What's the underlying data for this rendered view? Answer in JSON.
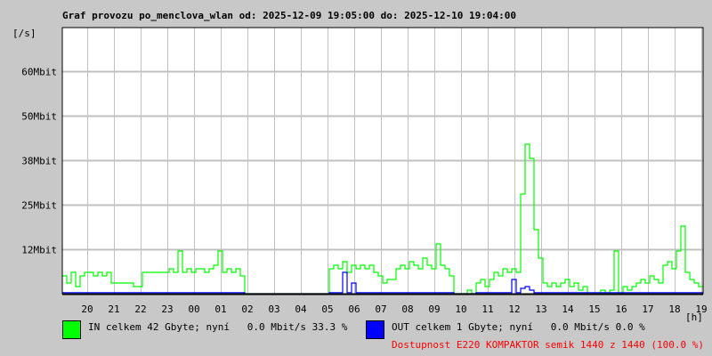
{
  "chart_data": {
    "type": "line",
    "title": "Graf provozu po_menclova_wlan od: 2025-12-09 19:05:00 do: 2025-12-10 19:04:00",
    "ylabel": "[/s]",
    "xlabel": "[h]",
    "ylim": [
      0,
      75
    ],
    "y_unit": "Mbit/s",
    "sample_interval_min": 10,
    "start_time": "19:05",
    "grid": true,
    "y_ticks": [
      {
        "label": "12Mbit",
        "value": 12.5
      },
      {
        "label": "25Mbit",
        "value": 25
      },
      {
        "label": "38Mbit",
        "value": 37.5
      },
      {
        "label": "50Mbit",
        "value": 50
      },
      {
        "label": "60Mbit",
        "value": 62.5
      }
    ],
    "x_ticks": [
      "20",
      "21",
      "22",
      "23",
      "00",
      "01",
      "02",
      "03",
      "04",
      "05",
      "06",
      "07",
      "08",
      "09",
      "10",
      "11",
      "12",
      "13",
      "14",
      "15",
      "16",
      "17",
      "18",
      "19"
    ],
    "series": [
      {
        "name": "IN",
        "color": "#00ff00",
        "values": [
          5,
          3,
          6,
          2,
          5,
          6,
          6,
          5,
          6,
          5,
          6,
          3,
          3,
          3,
          3,
          3,
          2,
          2,
          6,
          6,
          6,
          6,
          6,
          6,
          7,
          6,
          12,
          6,
          7,
          6,
          7,
          7,
          6,
          7,
          8,
          12,
          6,
          7,
          6,
          7,
          5,
          0,
          0,
          0,
          0,
          0,
          0,
          0,
          0,
          0,
          0,
          0,
          0,
          0,
          0,
          0,
          0,
          0,
          0,
          0,
          7,
          8,
          7,
          9,
          6,
          8,
          7,
          8,
          7,
          8,
          6,
          5,
          3,
          4,
          4,
          7,
          8,
          7,
          9,
          8,
          7,
          10,
          8,
          7,
          14,
          8,
          7,
          5,
          0,
          0,
          0,
          1,
          0,
          3,
          4,
          2,
          4,
          6,
          5,
          7,
          6,
          7,
          6,
          28,
          42,
          38,
          18,
          10,
          3,
          2,
          3,
          2,
          3,
          4,
          2,
          3,
          1,
          2,
          0,
          0,
          0,
          1,
          0,
          1,
          12,
          0,
          2,
          1,
          2,
          3,
          4,
          3,
          5,
          4,
          3,
          8,
          9,
          7,
          12,
          19,
          6,
          4,
          3,
          2
        ]
      },
      {
        "name": "OUT",
        "color": "#0000ff",
        "values": [
          0.3,
          0.3,
          0.3,
          0.3,
          0.3,
          0.3,
          0.3,
          0.3,
          0.3,
          0.3,
          0.3,
          0.3,
          0.3,
          0.3,
          0.3,
          0.3,
          0.3,
          0.3,
          0.3,
          0.3,
          0.3,
          0.3,
          0.3,
          0.3,
          0.3,
          0.3,
          0.3,
          0.3,
          0.3,
          0.3,
          0.3,
          0.3,
          0.3,
          0.3,
          0.3,
          0.3,
          0.3,
          0.3,
          0.3,
          0.3,
          0.3,
          0,
          0,
          0,
          0,
          0,
          0,
          0,
          0,
          0,
          0,
          0,
          0,
          0,
          0,
          0,
          0,
          0,
          0,
          0,
          0.3,
          0.3,
          0.3,
          6,
          0.3,
          3,
          0.3,
          0.3,
          0.3,
          0.3,
          0.3,
          0.3,
          0.3,
          0.3,
          0.3,
          0.3,
          0.3,
          0.3,
          0.3,
          0.3,
          0.3,
          0.3,
          0.3,
          0.3,
          0.3,
          0.3,
          0.3,
          0.3,
          0,
          0,
          0,
          0,
          0,
          0.3,
          0.3,
          0.3,
          0.3,
          0.3,
          0.3,
          0.3,
          0.3,
          4,
          0.3,
          1.5,
          2,
          1,
          0.3,
          0.3,
          0.3,
          0.3,
          0.3,
          0.3,
          0.3,
          0.3,
          0.3,
          0.3,
          0.3,
          0.3,
          0.3,
          0.3,
          0.3,
          0.3,
          0.3,
          0.3,
          0.3,
          0.3,
          0.3,
          0.3,
          0.3,
          0.3,
          0.3,
          0.3,
          0.3,
          0.3,
          0.3,
          0.3,
          0.3,
          0.3,
          0.3,
          0.3,
          0.3,
          0.3,
          0.3,
          0.3
        ]
      }
    ]
  },
  "legend": {
    "in": {
      "text": "IN celkem 42 Gbyte; nyní   0.0 Mbit/s 33.3 %",
      "color": "#00ff00"
    },
    "out": {
      "text": "OUT celkem 1 Gbyte; nyní   0.0 Mbit/s 0.0 %",
      "color": "#0000ff"
    },
    "availability": {
      "text": "Dostupnost E220 KOMPAKTOR semik 1440 z 1440 (100.0 %)",
      "color": "#ff0000"
    }
  }
}
